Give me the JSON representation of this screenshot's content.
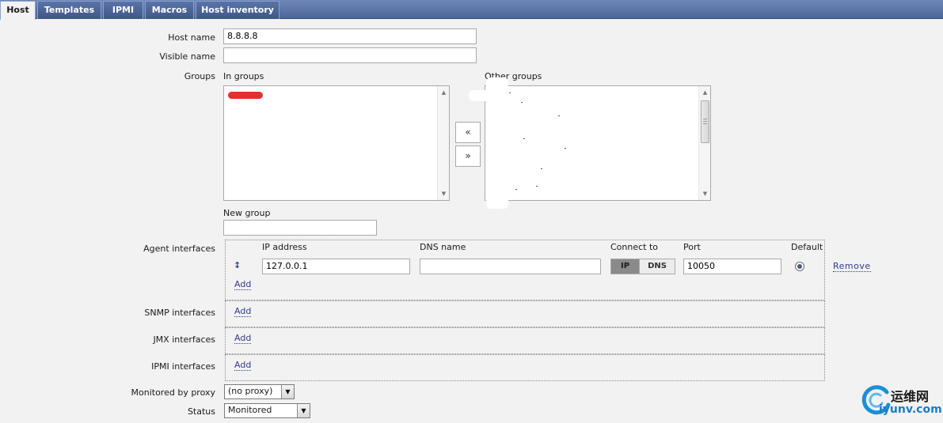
{
  "tabs": [
    {
      "label": "Host",
      "active": true
    },
    {
      "label": "Templates",
      "active": false
    },
    {
      "label": "IPMI",
      "active": false
    },
    {
      "label": "Macros",
      "active": false
    },
    {
      "label": "Host inventory",
      "active": false
    }
  ],
  "form": {
    "host_name_label": "Host name",
    "host_name_value": "8.8.8.8",
    "visible_name_label": "Visible name",
    "visible_name_value": "",
    "groups_label": "Groups",
    "in_groups_label": "In groups",
    "other_groups_label": "Other groups",
    "move_left_label": "«",
    "move_right_label": "»",
    "new_group_label": "New group",
    "new_group_value": "",
    "agent_interfaces_label": "Agent interfaces",
    "snmp_interfaces_label": "SNMP interfaces",
    "jmx_interfaces_label": "JMX interfaces",
    "ipmi_interfaces_label": "IPMI interfaces",
    "monitored_by_proxy_label": "Monitored by proxy",
    "monitored_by_proxy_value": "(no proxy)",
    "status_label": "Status",
    "status_value": "Monitored"
  },
  "interfaces": {
    "headers": {
      "ip": "IP address",
      "dns": "DNS name",
      "connect_to": "Connect to",
      "port": "Port",
      "default": "Default"
    },
    "agent": {
      "ip": "127.0.0.1",
      "dns": "",
      "connect_ip_label": "IP",
      "connect_dns_label": "DNS",
      "connect_selected": "IP",
      "port": "10050",
      "remove_label": "Remove"
    },
    "add_label": "Add"
  },
  "watermark": {
    "cn": "运维网",
    "domain": "iyunv.com"
  },
  "colors": {
    "tab_bar": "#4d6699",
    "link": "#2f3b8f",
    "page_bg": "#f2f2f2"
  }
}
